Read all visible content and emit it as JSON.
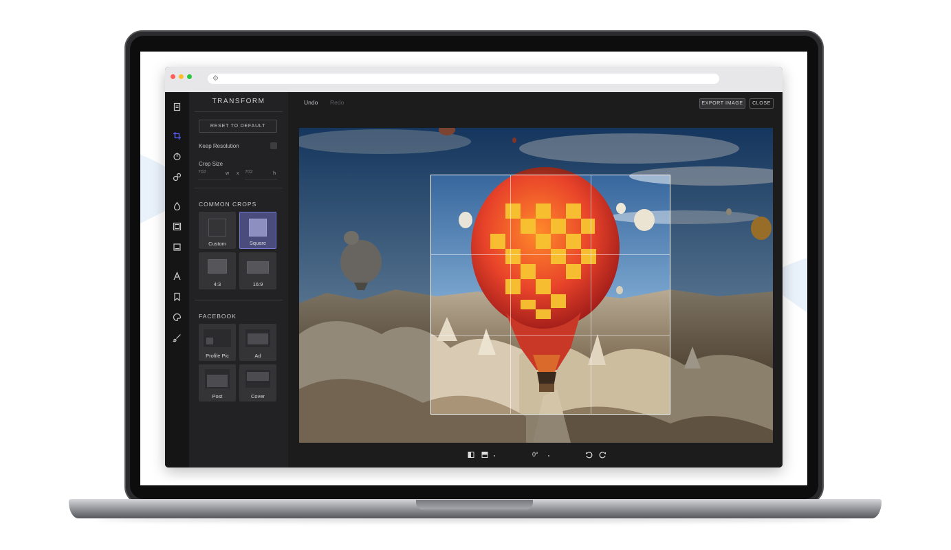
{
  "panel": {
    "title": "TRANSFORM",
    "reset_label": "RESET TO DEFAULT",
    "keep_resolution_label": "Keep Resolution",
    "crop_size_label": "Crop Size",
    "width_value": "702",
    "width_unit": "w",
    "times": "x",
    "height_value": "702",
    "height_unit": "h",
    "common_crops_label": "COMMON CROPS",
    "common_crops": [
      {
        "label": "Custom"
      },
      {
        "label": "Square"
      },
      {
        "label": "4:3"
      },
      {
        "label": "16:9"
      }
    ],
    "facebook_label": "FACEBOOK",
    "facebook_crops": [
      {
        "label": "Profile Pic"
      },
      {
        "label": "Ad"
      },
      {
        "label": "Post"
      },
      {
        "label": "Cover"
      }
    ]
  },
  "topbar": {
    "undo": "Undo",
    "redo": "Redo",
    "export": "EXPORT IMAGE",
    "close": "CLOSE"
  },
  "bottom_toolbar": {
    "rotation_angle": "0°"
  },
  "rail_icons": [
    "document-icon",
    "crop-icon",
    "adjust-icon",
    "filters-icon",
    "drop-icon",
    "frame-icon",
    "square-icon",
    "text-icon",
    "bookmark-icon",
    "palette-icon",
    "brush-icon"
  ],
  "colors": {
    "accent": "#5b63ff",
    "selected_tile": "#4a4d7c"
  }
}
